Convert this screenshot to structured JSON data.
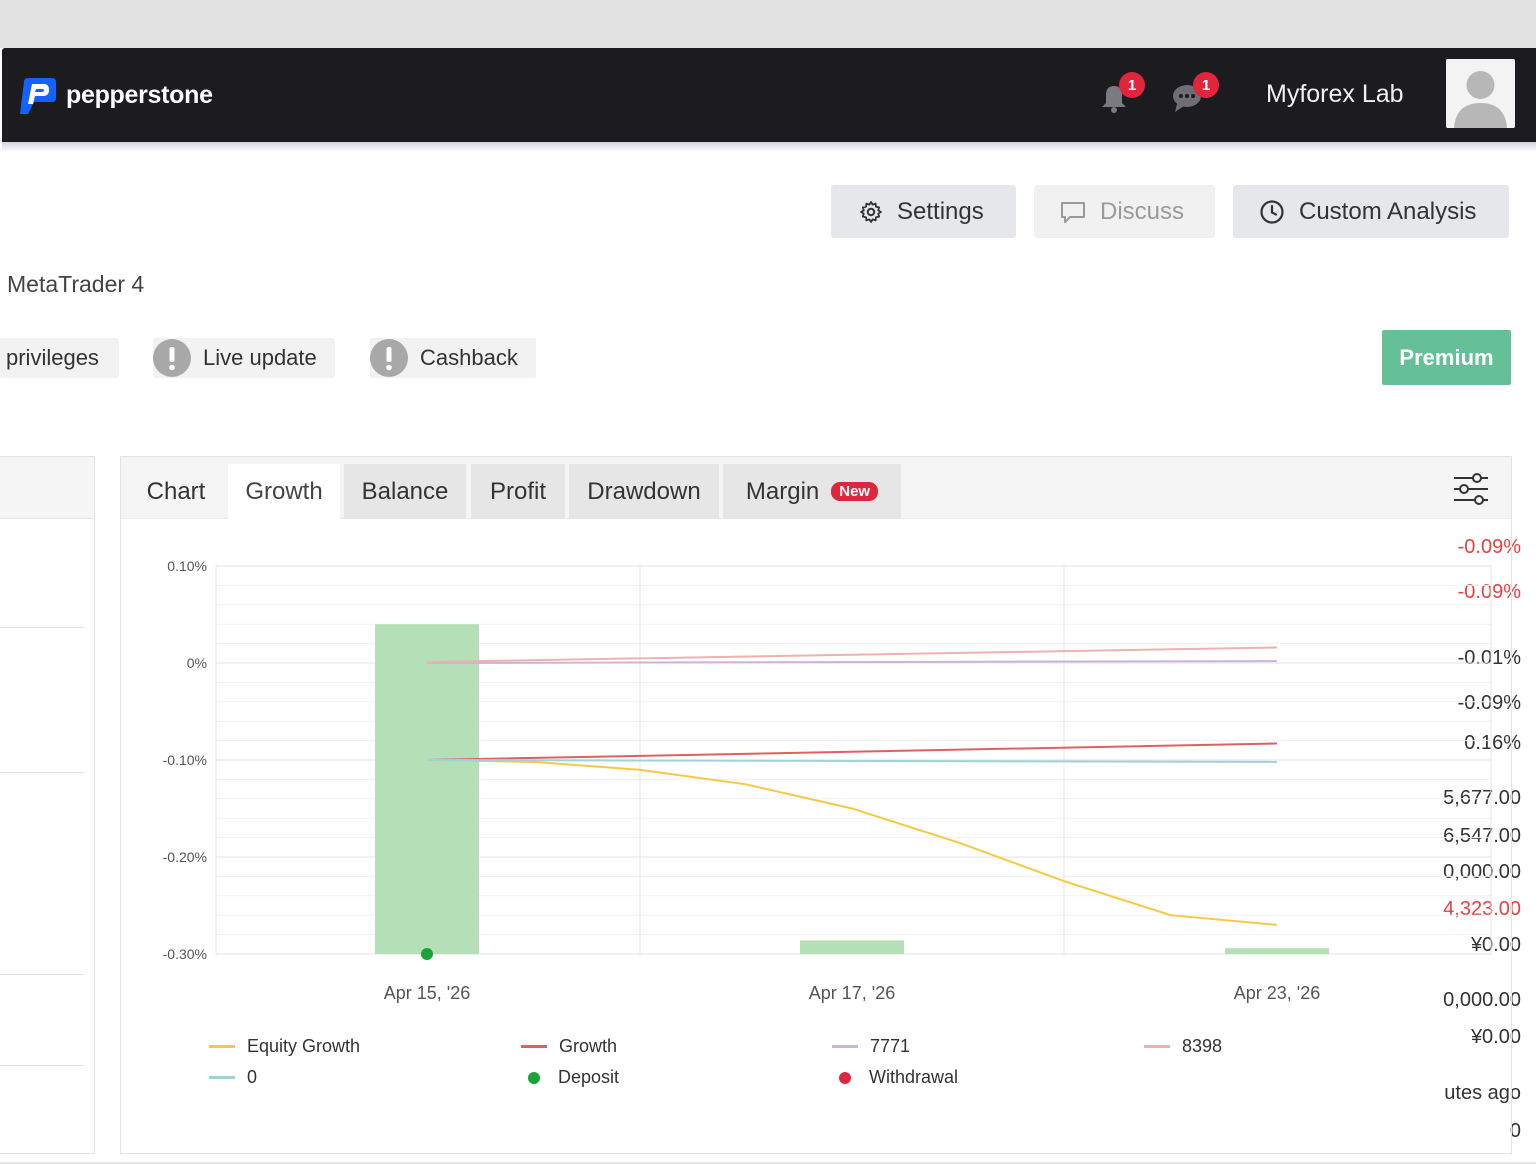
{
  "navbar": {
    "brand": "pepperstone",
    "notifications_count": "1",
    "messages_count": "1",
    "user_name": "Myforex Lab"
  },
  "toolbar": {
    "settings_label": "Settings",
    "discuss_label": "Discuss",
    "custom_analysis_label": "Custom Analysis"
  },
  "account": {
    "platform": "MetaTrader 4",
    "badges": [
      "privileges",
      "Live update",
      "Cashback"
    ],
    "premium_label": "Premium"
  },
  "stats": {
    "values": [
      "-0.09%",
      "-0.09%",
      "-0.01%",
      "-0.09%",
      "0.16%",
      "5,677.00",
      "6,547.00",
      "0,000.00",
      "4,323.00",
      "¥0.00",
      "0,000.00",
      "¥0.00",
      "utes ago",
      "0"
    ],
    "red_color": "#e84040"
  },
  "chart_tabs": {
    "chart": "Chart",
    "growth": "Growth",
    "balance": "Balance",
    "profit": "Profit",
    "drawdown": "Drawdown",
    "margin": "Margin",
    "new_badge": "New",
    "active": "Growth"
  },
  "chart_data": {
    "type": "line",
    "x": [
      "Apr 15, '26",
      "Apr 17, '26",
      "Apr 23, '26"
    ],
    "ylim": [
      -0.3,
      0.1
    ],
    "y_ticks": [
      "0.10%",
      "0%",
      "-0.10%",
      "-0.20%",
      "-0.30%"
    ],
    "series": [
      {
        "name": "Equity Growth",
        "type": "line",
        "color": "#f6c843",
        "points": [
          [
            0,
            -0.1
          ],
          [
            0.25,
            -0.102
          ],
          [
            0.5,
            -0.11
          ],
          [
            0.75,
            -0.125
          ],
          [
            1,
            -0.15
          ],
          [
            1.25,
            -0.185
          ],
          [
            1.5,
            -0.225
          ],
          [
            1.75,
            -0.26
          ],
          [
            2,
            -0.27
          ]
        ]
      },
      {
        "name": "Growth",
        "type": "line",
        "color": "#e06060",
        "points": [
          [
            0,
            -0.1
          ],
          [
            2,
            -0.083
          ]
        ]
      },
      {
        "name": "7771",
        "type": "line",
        "color": "#cbb3d9",
        "points": [
          [
            0,
            0.0
          ],
          [
            2,
            0.002
          ]
        ]
      },
      {
        "name": "8398",
        "type": "line",
        "color": "#f0b0b0",
        "points": [
          [
            0,
            0.001
          ],
          [
            2,
            0.016
          ]
        ]
      },
      {
        "name": "0",
        "type": "line",
        "color": "#9fd3d8",
        "points": [
          [
            0,
            -0.1
          ],
          [
            2,
            -0.102
          ]
        ]
      },
      {
        "name": "Deposit",
        "type": "scatter",
        "color": "#1aa33a",
        "points": [
          [
            0,
            -0.3
          ]
        ]
      },
      {
        "name": "Withdrawal",
        "type": "scatter",
        "color": "#e0263d",
        "points": []
      }
    ],
    "bars": {
      "color": "#b4dfb7",
      "x": [
        0,
        1,
        2
      ],
      "top_values": [
        0.04,
        -0.286,
        -0.294
      ],
      "baseline": -0.3
    },
    "grid": true,
    "legend_position": "bottom"
  },
  "legend": {
    "items": [
      {
        "label": "Equity Growth",
        "color": "#f6c843",
        "kind": "line"
      },
      {
        "label": "Growth",
        "color": "#e06060",
        "kind": "line"
      },
      {
        "label": "7771",
        "color": "#cbb3d9",
        "kind": "line"
      },
      {
        "label": "8398",
        "color": "#f0b0b0",
        "kind": "line"
      },
      {
        "label": "0",
        "color": "#9fd3d8",
        "kind": "line"
      },
      {
        "label": "Deposit",
        "color": "#1aa33a",
        "kind": "dot"
      },
      {
        "label": "Withdrawal",
        "color": "#e0263d",
        "kind": "dot"
      }
    ]
  }
}
